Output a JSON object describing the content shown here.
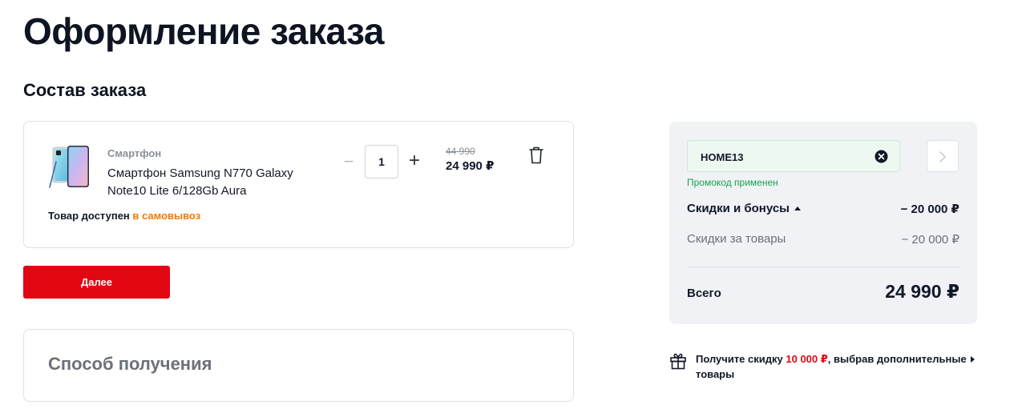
{
  "page": {
    "title": "Оформление заказа"
  },
  "order": {
    "section_title": "Состав заказа",
    "item": {
      "image": "smartphone-image",
      "category": "Смартфон",
      "name": "Смартфон Samsung N770 Galaxy Note10 Lite 6/128Gb Aura",
      "quantity": "1",
      "old_price": "44 990",
      "price": "24 990 ₽",
      "availability_text": "Товар доступен",
      "availability_link": "в самовывоз",
      "availability_link_color": "#f07c00"
    },
    "next_button": "Далее",
    "next_button_color": "#e30613"
  },
  "delivery": {
    "title": "Способ получения"
  },
  "summary": {
    "promo_code": "HOME13",
    "promo_status": "Промокод применен",
    "discounts_label": "Скидки и бонусы",
    "discounts_value": "− 20 000 ₽",
    "items_discount_label": "Скидки за товары",
    "items_discount_value": "− 20 000 ₽",
    "total_label": "Всего",
    "total_value": "24 990 ₽"
  },
  "offer": {
    "icon": "gift-icon",
    "text_before": "Получите скидку",
    "amount": "10 000 ₽",
    "text_after": ", выбрав дополнительные товары"
  }
}
